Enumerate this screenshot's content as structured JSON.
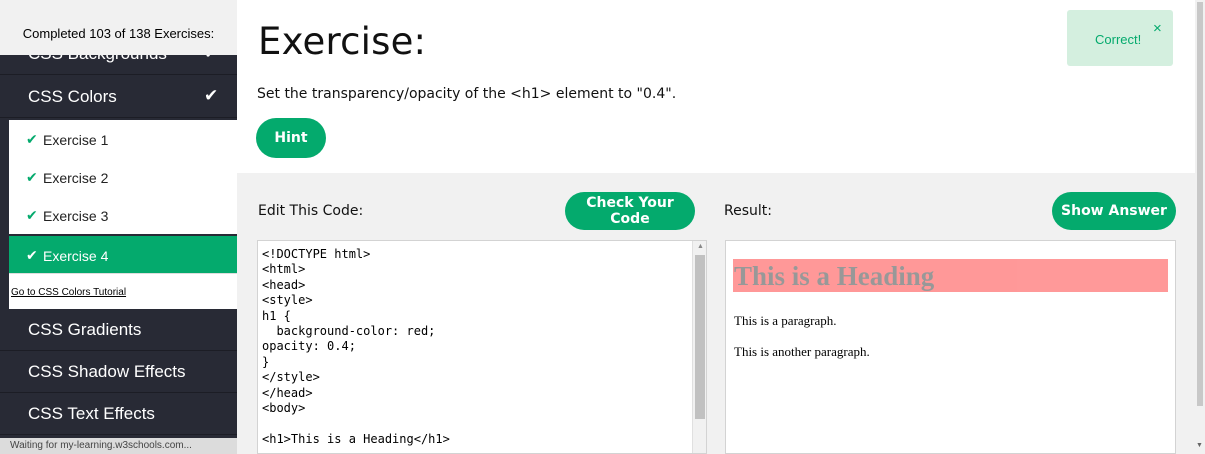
{
  "sidebar": {
    "progress_text": "Completed 103 of 138 Exercises:",
    "peek_item": {
      "label": "CSS Backgrounds",
      "check": "✔"
    },
    "current_section": {
      "label": "CSS Colors",
      "check": "✔"
    },
    "exercises": [
      {
        "label": "Exercise 1",
        "check": "✔"
      },
      {
        "label": "Exercise 2",
        "check": "✔"
      },
      {
        "label": "Exercise 3",
        "check": "✔"
      },
      {
        "label": "Exercise 4",
        "check": "✔",
        "active": true
      }
    ],
    "tutorial_link": "Go to CSS Colors Tutorial",
    "sections": [
      "CSS Gradients",
      "CSS Shadow Effects",
      "CSS Text Effects"
    ],
    "status_text": "Waiting for my-learning.w3schools.com..."
  },
  "main": {
    "title": "Exercise:",
    "instruction": "Set the transparency/opacity of the <h1> element to \"0.4\".",
    "hint_label": "Hint",
    "toast": {
      "text": "Correct!",
      "close": "×"
    },
    "edit_label": "Edit This Code:",
    "check_label": "Check Your Code",
    "result_label": "Result:",
    "answer_label": "Show Answer",
    "code": [
      "<!DOCTYPE html>",
      "<html>",
      "<head>",
      "<style>",
      "h1 {",
      "  background-color: red;",
      "opacity: 0.4;",
      "}",
      "</style>",
      "</head>",
      "<body>",
      "",
      "<h1>This is a Heading</h1>"
    ],
    "result": {
      "heading": "This is a Heading",
      "heading_opacity": 0.4,
      "p1": "This is a paragraph.",
      "p2": "This is another paragraph."
    }
  },
  "colors": {
    "accent": "#04aa6d",
    "sidebar_bg": "#282a35",
    "toast_bg": "#d4efdf",
    "panel_bg": "#f1f1f1"
  },
  "icons": {
    "check": "check-icon",
    "close": "close-icon",
    "scroll_up": "scroll-up-arrow-icon",
    "scroll_down": "scroll-down-arrow-icon"
  }
}
